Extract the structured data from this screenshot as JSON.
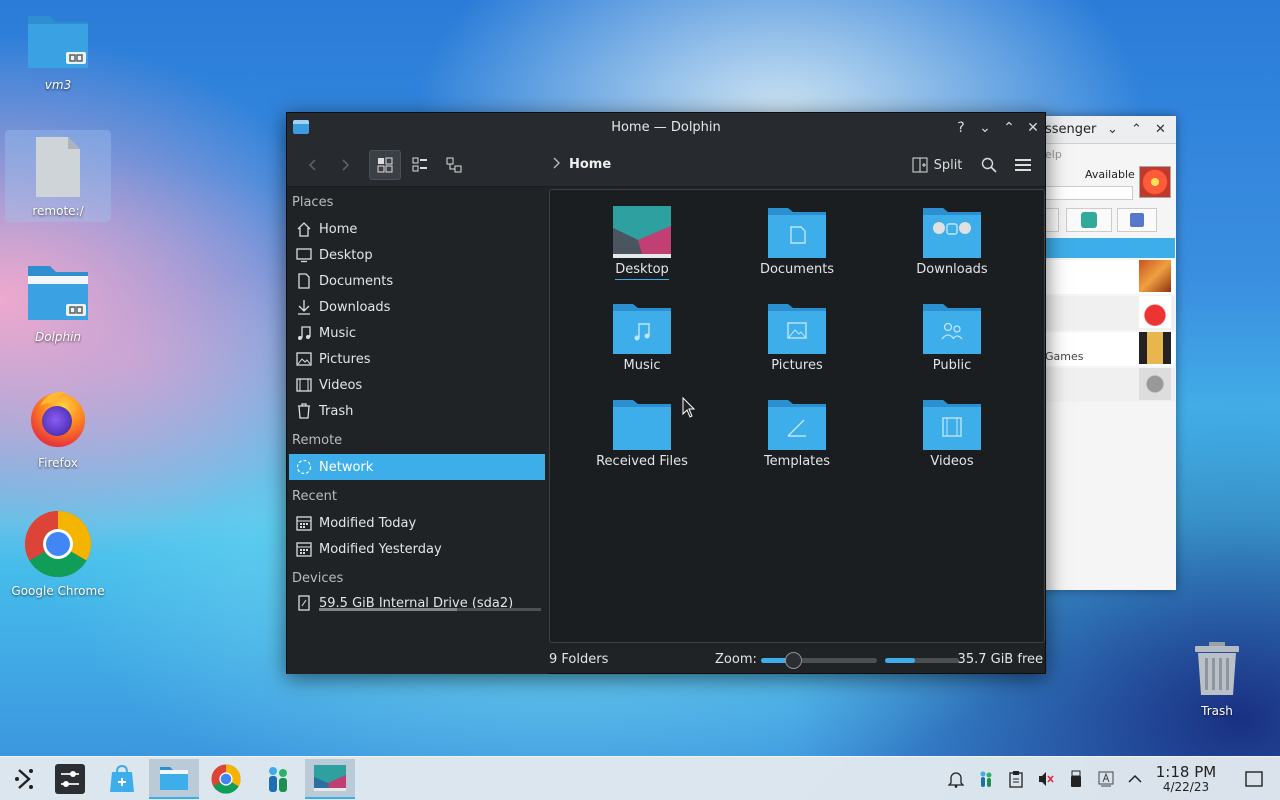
{
  "desktop": {
    "icons": [
      {
        "label": "vm3",
        "icon": "folder-link-icon"
      },
      {
        "label": "remote:/",
        "icon": "file-icon"
      },
      {
        "label": "Dolphin",
        "icon": "folder-link-icon"
      },
      {
        "label": "Firefox",
        "icon": "firefox-icon"
      },
      {
        "label": "Google Chrome",
        "icon": "chrome-icon"
      },
      {
        "label": "Trash",
        "icon": "trash-icon"
      }
    ]
  },
  "background_window": {
    "title": "ssenger",
    "menu_fragment": "elp",
    "status": "Available",
    "group_fragment": "Games"
  },
  "dolphin": {
    "title": "Home — Dolphin",
    "toolbar": {
      "split_label": "Split",
      "breadcrumb": "Home"
    },
    "places": {
      "places_header": "Places",
      "places_items": [
        "Home",
        "Desktop",
        "Documents",
        "Downloads",
        "Music",
        "Pictures",
        "Videos",
        "Trash"
      ],
      "remote_header": "Remote",
      "remote_items": [
        "Network"
      ],
      "recent_header": "Recent",
      "recent_items": [
        "Modified Today",
        "Modified Yesterday"
      ],
      "devices_header": "Devices",
      "devices_items": [
        "59.5 GiB Internal Drive (sda2)"
      ]
    },
    "folders": [
      "Desktop",
      "Documents",
      "Downloads",
      "Music",
      "Pictures",
      "Public",
      "Received Files",
      "Templates",
      "Videos"
    ],
    "status": {
      "count": "9 Folders",
      "zoom_label": "Zoom:",
      "zoom_level": 0.3,
      "free_space": "35.7 GiB free",
      "used_fraction": 0.4
    }
  },
  "taskbar": {
    "apps": [
      "application-launcher-icon",
      "settings-icon",
      "discover-icon",
      "dolphin-icon",
      "chrome-icon",
      "messenger-icon",
      "desktop-preview-icon"
    ],
    "time": "1:18 PM",
    "date": "4/22/23"
  },
  "colors": {
    "accent": "#3daee9",
    "window_bg": "#202326",
    "folder_blue": "#3daee9"
  }
}
